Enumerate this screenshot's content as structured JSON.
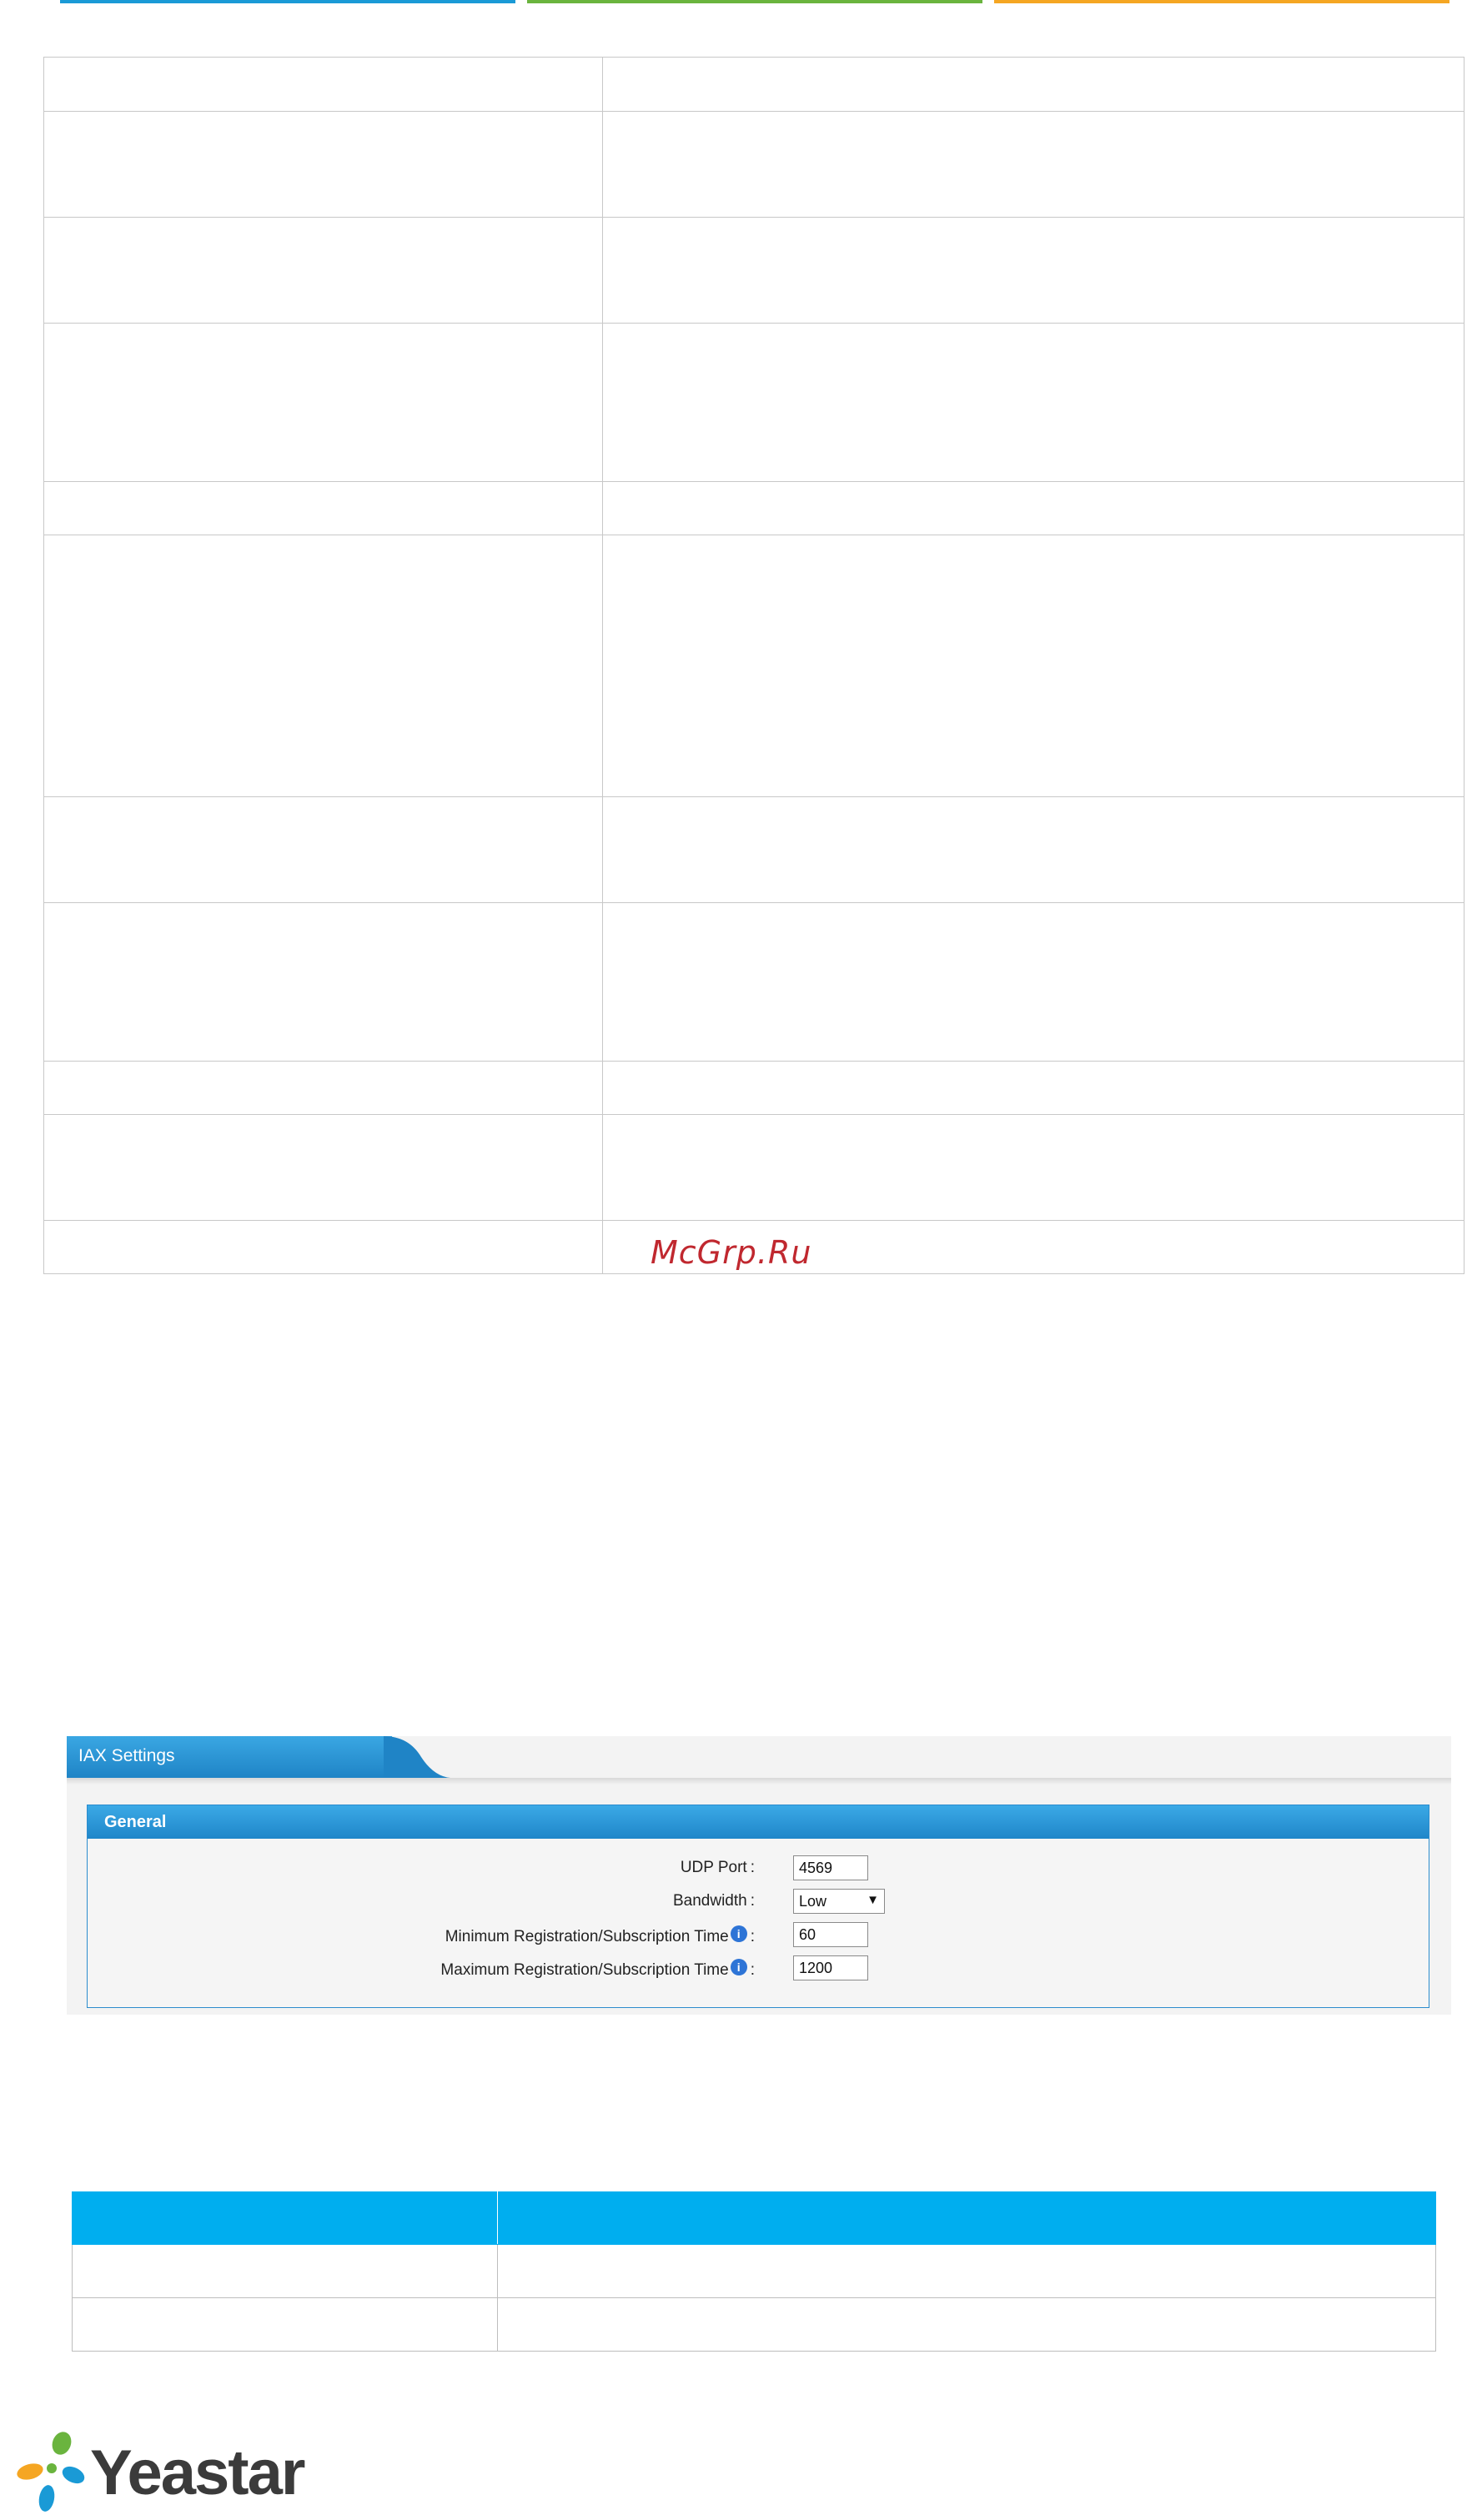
{
  "colors": {
    "bar_blue": "#1a9ad6",
    "bar_green": "#6ab43e",
    "bar_orange": "#f5a623",
    "panel_header": "#2b8ccd",
    "table_header": "#00aeef",
    "watermark": "#c0282f"
  },
  "watermark": "McGrp.Ru",
  "iax_panel": {
    "tab_title": "IAX Settings",
    "section_title": "General",
    "fields": [
      {
        "label": "UDP Port",
        "value": "4569",
        "type": "input"
      },
      {
        "label": "Bandwidth",
        "value": "Low",
        "type": "select"
      },
      {
        "label": "Minimum Registration/Subscription Time",
        "value": "60",
        "type": "input",
        "info": true
      },
      {
        "label": "Maximum Registration/Subscription Time",
        "value": "1200",
        "type": "input",
        "info": true
      }
    ]
  },
  "icons": {
    "info": "info-icon",
    "dropdown": "chevron-down-icon",
    "logo_mark": "yeastar-logo-icon"
  },
  "logo": {
    "text": "Yeastar"
  }
}
